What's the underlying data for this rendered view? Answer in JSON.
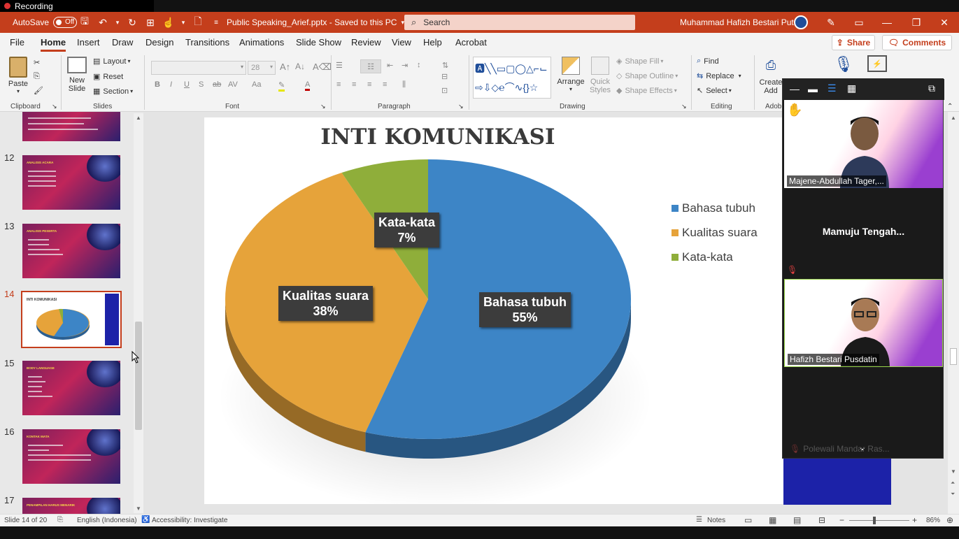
{
  "recording": {
    "label": "Recording"
  },
  "titlebar": {
    "autosave_label": "AutoSave",
    "autosave_state": "Off",
    "doc_title": "Public Speaking_Arief.pptx  -  Saved to this PC",
    "search_placeholder": "Search",
    "user_name": "Muhammad Hafizh Bestari Putra",
    "accent_color": "#c43e1c"
  },
  "menu": {
    "items": [
      "File",
      "Home",
      "Insert",
      "Draw",
      "Design",
      "Transitions",
      "Animations",
      "Slide Show",
      "Review",
      "View",
      "Help",
      "Acrobat"
    ],
    "active": "Home",
    "share": "Share",
    "comments": "Comments"
  },
  "ribbon": {
    "clipboard": {
      "paste": "Paste",
      "label": "Clipboard"
    },
    "slides": {
      "new_slide": "New",
      "new_slide2": "Slide",
      "layout": "Layout",
      "reset": "Reset",
      "section": "Section",
      "label": "Slides"
    },
    "font": {
      "size": "28",
      "label": "Font"
    },
    "paragraph": {
      "label": "Paragraph"
    },
    "drawing": {
      "arrange": "Arrange",
      "quick_styles": "Quick",
      "quick_styles2": "Styles",
      "shape_fill": "Shape Fill",
      "shape_outline": "Shape Outline",
      "shape_effects": "Shape Effects",
      "label": "Drawing"
    },
    "editing": {
      "find": "Find",
      "replace": "Replace",
      "select": "Select",
      "label": "Editing"
    },
    "adobe": {
      "create": "Create",
      "create2": "Add",
      "label": "Adob"
    }
  },
  "thumbnails": [
    {
      "num": "12",
      "title": "ANALISIS ACARA"
    },
    {
      "num": "13",
      "title": "ANALISIS PESERTA"
    },
    {
      "num": "14",
      "title": "INTI KOMUNIKASI",
      "selected": true
    },
    {
      "num": "15",
      "title": "BODY LANGUAGE"
    },
    {
      "num": "16",
      "title": "KONTAK MATA"
    },
    {
      "num": "17",
      "title": "PENAMPILAN HARUS MENARIK"
    }
  ],
  "slide": {
    "title": "INTI KOMUNIKASI"
  },
  "chart_data": {
    "type": "pie",
    "title": "INTI KOMUNIKASI",
    "categories": [
      "Bahasa tubuh",
      "Kualitas suara",
      "Kata-kata"
    ],
    "values": [
      55,
      38,
      7
    ],
    "data_labels": [
      {
        "name": "Bahasa tubuh",
        "pct": "55%"
      },
      {
        "name": "Kualitas suara",
        "pct": "38%"
      },
      {
        "name": "Kata-kata",
        "pct": "7%"
      }
    ],
    "colors": [
      "#3d85c6",
      "#e6a33a",
      "#8fae3a"
    ],
    "legend_position": "right",
    "style": "3d"
  },
  "zoom": {
    "participants": [
      {
        "name": "Majene-Abdullah Tager,..."
      },
      {
        "name": "Mamuju  Tengah..."
      },
      {
        "name": "Hafizh Bestari Pusdatin"
      },
      {
        "name": "Polewali Mandar Ras..."
      }
    ]
  },
  "status": {
    "slide_info": "Slide 14 of 20",
    "language": "English (Indonesia)",
    "accessibility": "Accessibility: Investigate",
    "notes": "Notes",
    "zoom_level": "86%"
  }
}
